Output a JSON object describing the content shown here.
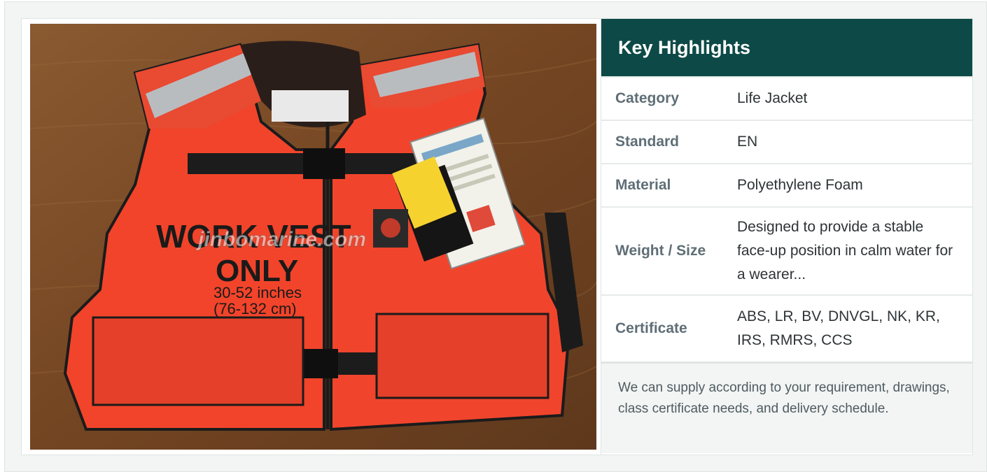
{
  "image": {
    "alt": "Orange work vest life jacket",
    "print": {
      "line1": "WORK VEST",
      "line2": "ONLY",
      "size_in": "30-52 inches",
      "size_cm": "(76-132 cm)",
      "watermark": "jinbomarine.com"
    }
  },
  "highlights": {
    "title": "Key Highlights",
    "rows": [
      {
        "label": "Category",
        "value": "Life Jacket"
      },
      {
        "label": "Standard",
        "value": "EN"
      },
      {
        "label": "Material",
        "value": "Polyethylene Foam"
      },
      {
        "label": "Weight / Size",
        "value": "Designed to provide a stable face-up position in calm water for a wearer..."
      },
      {
        "label": "Certificate",
        "value": "ABS, LR, BV, DNVGL, NK, KR, IRS, RMRS, CCS"
      }
    ],
    "note": "We can supply according to your requirement, drawings, class certificate needs, and delivery schedule."
  },
  "colors": {
    "header_bg": "#0d4a47",
    "vest_orange": "#f2442a",
    "wood": "#7a4a26"
  }
}
